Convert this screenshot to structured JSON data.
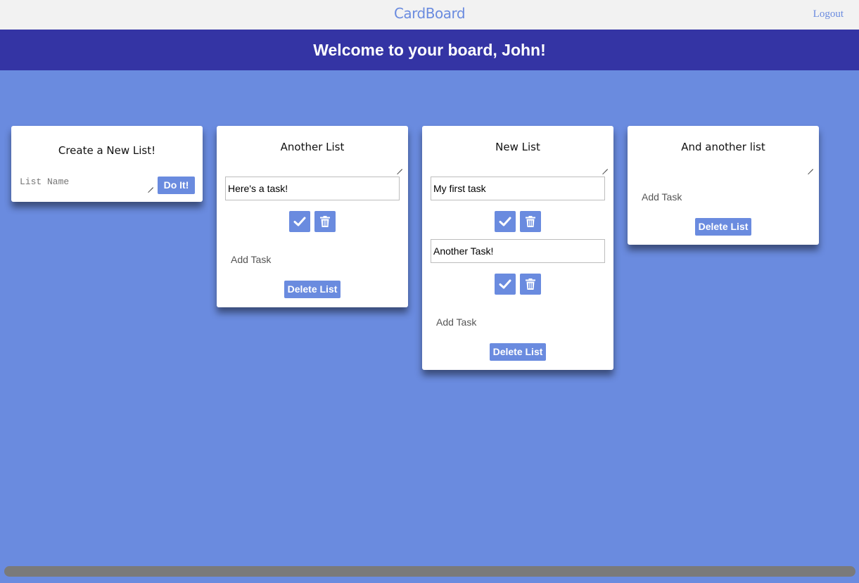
{
  "app": {
    "brand": "CardBoard",
    "logout": "Logout"
  },
  "banner": {
    "welcome": "Welcome to your board, John!"
  },
  "new_list": {
    "title": "Create a New List!",
    "placeholder": "List Name",
    "submit": "Do It!"
  },
  "lists": [
    {
      "title": "Another List",
      "tasks": [
        "Here's a task!"
      ],
      "add_task": "Add Task",
      "delete": "Delete List"
    },
    {
      "title": "New List",
      "tasks": [
        "My first task",
        "Another Task!"
      ],
      "add_task": "Add Task",
      "delete": "Delete List"
    },
    {
      "title": "And another list",
      "tasks": [],
      "add_task": "Add Task",
      "delete": "Delete List"
    }
  ],
  "colors": {
    "background": "#6a8bdf",
    "banner": "#3434a4",
    "accent": "#6a8bdf",
    "topbar": "#f2f2f2"
  },
  "icons": {
    "complete": "check-icon",
    "delete": "trash-icon"
  }
}
